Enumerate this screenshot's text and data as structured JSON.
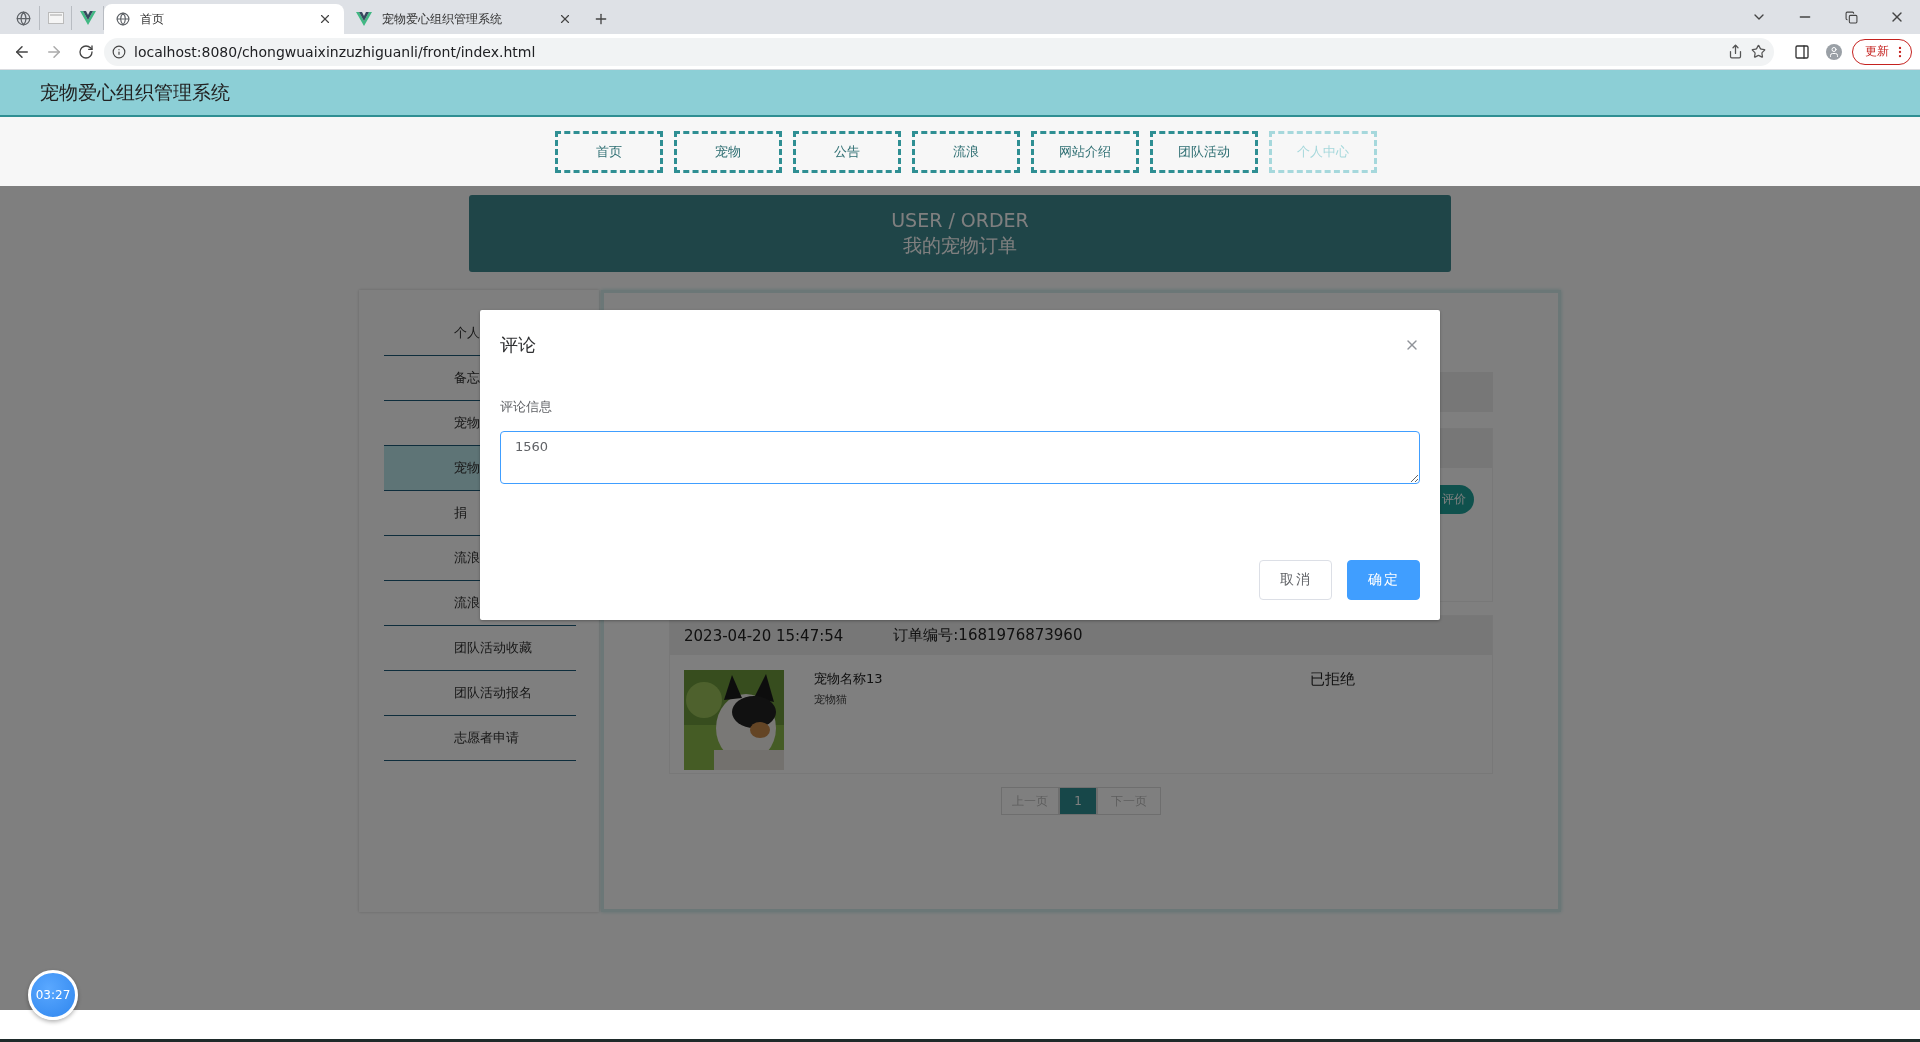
{
  "browser": {
    "tabs": [
      {
        "kind": "pinned",
        "selected": false
      },
      {
        "kind": "pinned",
        "selected": false
      },
      {
        "kind": "pinned",
        "selected": false
      },
      {
        "kind": "titled",
        "title": "首页",
        "selected": true
      },
      {
        "kind": "titled",
        "title": "宠物爱心组织管理系统",
        "selected": false
      }
    ],
    "url": "localhost:8080/chongwuaixinzuzhiguanli/front/index.html",
    "update_button": "更新"
  },
  "site": {
    "title": "宠物爱心组织管理系统",
    "nav": [
      {
        "label": "首页",
        "selected": false
      },
      {
        "label": "宠物",
        "selected": false
      },
      {
        "label": "公告",
        "selected": false
      },
      {
        "label": "流浪",
        "selected": false
      },
      {
        "label": "网站介绍",
        "selected": false
      },
      {
        "label": "团队活动",
        "selected": false
      },
      {
        "label": "个人中心",
        "selected": true
      }
    ]
  },
  "banner": {
    "title_en": "USER / ORDER",
    "title_cn": "我的宠物订单"
  },
  "sidebar": {
    "items": [
      {
        "label": "个人",
        "selected": false
      },
      {
        "label": "备忘",
        "selected": false
      },
      {
        "label": "宠物",
        "selected": false
      },
      {
        "label": "宠物",
        "selected": true
      },
      {
        "label": "捐",
        "selected": false
      },
      {
        "label": "流浪",
        "selected": false
      },
      {
        "label": "流浪",
        "selected": false
      },
      {
        "label": "团队活动收藏",
        "selected": false
      },
      {
        "label": "团队活动报名",
        "selected": false
      },
      {
        "label": "志愿者申请",
        "selected": false
      }
    ]
  },
  "orders": [
    {
      "action": "评价"
    },
    {
      "date": "2023-04-20 15:47:54",
      "order_no": "订单编号:1681976873960",
      "pet_name": "宠物名称13",
      "pet_type": "宠物猫",
      "status": "已拒绝"
    }
  ],
  "pagination": {
    "prev": "上一页",
    "pages": [
      {
        "label": "1",
        "selected": true
      }
    ],
    "next": "下一页"
  },
  "dialog": {
    "title": "评论",
    "field_label": "评论信息",
    "value": "1560",
    "buttons": [
      {
        "label": "取消",
        "kind": "secondary"
      },
      {
        "label": "确定",
        "kind": "primary"
      }
    ]
  },
  "timer": "03:27"
}
